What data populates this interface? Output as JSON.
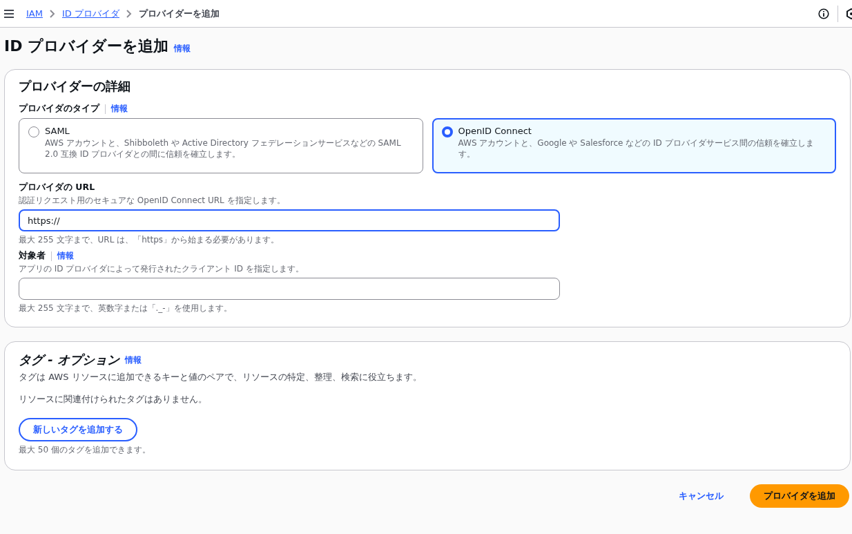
{
  "breadcrumbs": [
    {
      "label": "IAM",
      "kind": "link"
    },
    {
      "label": "ID プロバイダ",
      "kind": "link"
    },
    {
      "label": "プロバイダーを追加",
      "kind": "current"
    }
  ],
  "page_title": "ID プロバイダーを追加",
  "page_info": "情報",
  "details": {
    "title": "プロバイダーの詳細",
    "type_label": "プロバイダのタイプ",
    "type_info": "情報",
    "options": [
      {
        "label": "SAML",
        "description": "AWS アカウントと、Shibboleth や Active Directory フェデレーションサービスなどの SAML 2.0 互換 ID プロバイダとの間に信頼を確立します。",
        "selected": false
      },
      {
        "label": "OpenID Connect",
        "description": "AWS アカウントと、Google や Salesforce などの ID プロバイダサービス間の信頼を確立します。",
        "selected": true
      }
    ],
    "fields": [
      {
        "label": "プロバイダの URL",
        "description": "認証リクエスト用のセキュアな OpenID Connect URL を指定します。",
        "value": "https://",
        "focused": true,
        "constraint": "最大 255 文字まで、URL は、「https」から始まる必要があります。"
      },
      {
        "label": "対象者",
        "info": "情報",
        "description": "アプリの ID プロバイダによって発行されたクライアント ID を指定します。",
        "focused": false,
        "constraint": "最大 255 文字まで、英数字または「._-」を使用します。"
      }
    ]
  },
  "tags": {
    "title": "タグ - オプション",
    "info": "情報",
    "description": "タグは AWS リソースに追加できるキーと値のペアで、リソースの特定、整理、検索に役立ちます。",
    "empty": "リソースに関連付けられたタグはありません。",
    "add_button": "新しいタグを追加する",
    "limit": "最大 50 個のタグを追加できます。"
  },
  "footer": {
    "cancel": "キャンセル",
    "submit": "プロバイダを追加"
  }
}
